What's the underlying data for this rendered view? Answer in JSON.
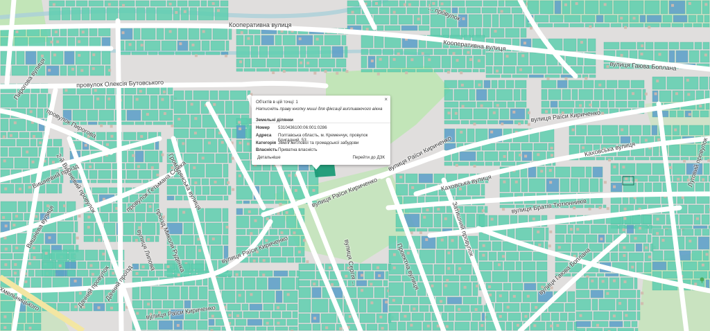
{
  "map": {
    "colors": {
      "background": "#e0dedd",
      "road": "#ffffff",
      "parcel": "#5fcfb0",
      "parcel_dark": "#3fb596",
      "building": "#d1b9ad",
      "building_blue": "#5a9ec8",
      "park": "#bfe5b4",
      "water": "#aad0da",
      "selected": "#1b9a76"
    },
    "streets": [
      {
        "id": "kooperatyvna-1",
        "label": "Кооперативна вулиця"
      },
      {
        "id": "kooperatyvna-2",
        "label": "Кооперативна вулиця"
      },
      {
        "id": "hayovy",
        "label": "... провулок"
      },
      {
        "id": "haivyi",
        "label": "вулиця Гаюва Боплана"
      },
      {
        "id": "butovskoho",
        "label": "провулок Олексія Бутовського"
      },
      {
        "id": "pyrohova-v",
        "label": "Пирогова вулиця"
      },
      {
        "id": "pyrohova-p",
        "label": "провулок Пирогова"
      },
      {
        "id": "kyrychenko-1",
        "label": "вулиця Раїси Кириченко"
      },
      {
        "id": "kyrychenko-2",
        "label": "вулиця Раїси Кириченко"
      },
      {
        "id": "kyrychenko-3",
        "label": "вулиця Раїси Кириченко"
      },
      {
        "id": "kyrychenko-4",
        "label": "вулиця Раїси Кириченко"
      },
      {
        "id": "kyrychenko-5",
        "label": "вулиця Раїси Кириченко"
      },
      {
        "id": "kakhovska-1",
        "label": "Каховська вулиця"
      },
      {
        "id": "kakhovska-2",
        "label": "Каховська вулиця"
      },
      {
        "id": "tiutiunnykiv",
        "label": "вулиця Братів Тютюнників"
      },
      {
        "id": "luhovyi",
        "label": "Луговий провулок"
      },
      {
        "id": "boplana-2",
        "label": "вулиця Гаюва Боплана"
      },
      {
        "id": "vyshnevy-p",
        "label": "2-й Вишневий провулок"
      },
      {
        "id": "vyshnevy-pr",
        "label": "Вишневий проїзд"
      },
      {
        "id": "vyshneva",
        "label": "Вишнева вулиця"
      },
      {
        "id": "somka",
        "label": "провулок Гетьмана Сомка"
      },
      {
        "id": "hromadianska",
        "label": "Громадянська вулиця"
      },
      {
        "id": "muzhenko",
        "label": "проїзд Миколи Руденка"
      },
      {
        "id": "lypova",
        "label": "вулиця Липова"
      },
      {
        "id": "dachnyi-pr",
        "label": "Дачний проїзд"
      },
      {
        "id": "dachnyi-p",
        "label": "Дачний провулок"
      },
      {
        "id": "khmelnytskoho",
        "label": "Хмельницького"
      },
      {
        "id": "proektna",
        "label": "Проектна вулиця"
      },
      {
        "id": "zatyshnyi",
        "label": "Затишний провулок"
      },
      {
        "id": "slavy",
        "label": "вулиця Сергія ..."
      }
    ]
  },
  "popup": {
    "objects_count": "Об'єктів в цій точці: 1",
    "hint": "Натисніть праву кнопку миші для фіксації випливаючого вікна",
    "section_title": "Земельні ділянки",
    "rows": [
      {
        "key": "Номер",
        "value": "5310436100:06:001:0286"
      },
      {
        "key": "Адреса",
        "value": "Полтавська область, м. Кременчук, провулок Бригадний, 53"
      },
      {
        "key": "Категорія",
        "value": "Землі житлової та громадської забудови"
      },
      {
        "key": "Власність",
        "value": "Приватна власність"
      }
    ],
    "details_label": "Детальніше",
    "goto_label": "Перейти до ДЗК",
    "close_symbol": "×"
  }
}
